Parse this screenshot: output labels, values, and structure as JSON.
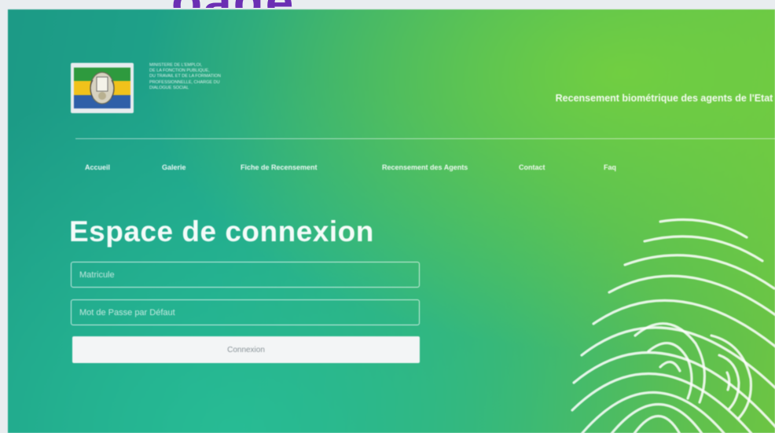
{
  "header_fragment": "oage",
  "ministry_lines": [
    "MINISTERE DE L'EMPLOI,",
    "DE LA FONCTION PUBLIQUE,",
    "DU TRAVAIL ET DE LA FORMATION",
    "PROFESSIONNELLE, CHARGE DU",
    "DIALOGUE SOCIAL"
  ],
  "site_title": "Recensement biométrique des agents de l'Etat",
  "nav": [
    {
      "label": "Accueil"
    },
    {
      "label": "Galerie"
    },
    {
      "label": "Fiche de Recensement"
    },
    {
      "label": "Recensement des Agents"
    },
    {
      "label": "Contact"
    },
    {
      "label": "Faq"
    }
  ],
  "login": {
    "title": "Espace de connexion",
    "matricule_placeholder": "Matricule",
    "password_placeholder": "Mot de Passe par Défaut",
    "submit_label": "Connexion"
  },
  "colors": {
    "flag_green": "#2e9a3e",
    "flag_yellow": "#f1c21b",
    "flag_blue": "#2f5fa8",
    "accent_purple": "#6b2fb3"
  },
  "icons": {
    "logo": "gabon-coat-of-arms-logo",
    "fingerprint": "fingerprint-icon"
  }
}
